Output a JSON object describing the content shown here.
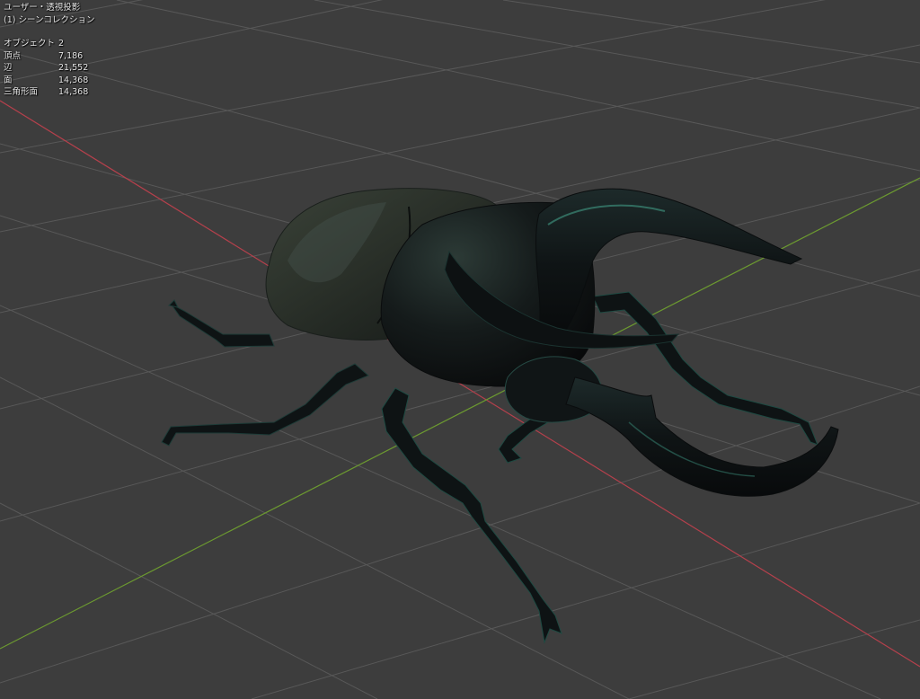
{
  "viewport": {
    "view_name": "ユーザー・透視投影",
    "collection": "(1) シーンコレクション"
  },
  "statistics": [
    {
      "label": "オブジェクト",
      "value": "2"
    },
    {
      "label": "頂点",
      "value": "7,186"
    },
    {
      "label": "辺",
      "value": "21,552"
    },
    {
      "label": "面",
      "value": "14,368"
    },
    {
      "label": "三角形面",
      "value": "14,368"
    }
  ],
  "colors": {
    "background": "#3d3d3d",
    "grid_line": "#565656",
    "x_axis": "#b5404c",
    "y_axis": "#6c9a30",
    "beetle_body": "#12181a",
    "beetle_elytra": "#2a3029",
    "beetle_highlight": "#3c8a78"
  },
  "object": {
    "icon": "rhinoceros-beetle-3d-model"
  }
}
